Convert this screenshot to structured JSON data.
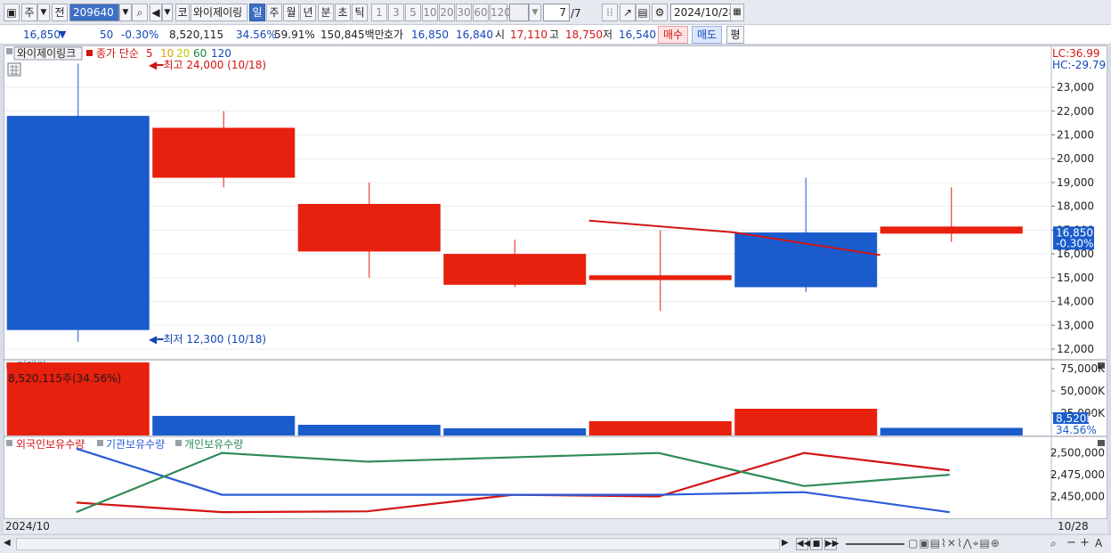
{
  "toolbar": {
    "market_type": "주",
    "prev_label": "전",
    "stock_code": "209640",
    "stock_name_btn": "코",
    "stock_name": "와이제이링",
    "periods": [
      "일",
      "주",
      "월",
      "년",
      "분",
      "초",
      "틱"
    ],
    "active_period": "일",
    "intervals": [
      "1",
      "3",
      "5",
      "10",
      "20",
      "30",
      "60",
      "120"
    ],
    "page_counter": "7",
    "page_total": "/7",
    "date": "2024/10/28"
  },
  "quote": {
    "price": "16,850",
    "direction_icon": "▼",
    "change": "50",
    "change_pct": "-0.30%",
    "volume": "8,520,115",
    "volume_ratio": "34.56%",
    "foreign_ratio": "59.91%",
    "trade_amount": "150,845백만",
    "ask_label": "호가",
    "ask": "16,850",
    "bid": "16,840",
    "open_label": "시",
    "open": "17,110",
    "high_label": "고",
    "high": "18,750",
    "low_label": "저",
    "low": "16,540",
    "buy_label": "매수",
    "sell_label": "매도",
    "eval_label": "평"
  },
  "chart_data": [
    {
      "type": "candlestick",
      "title": "와이제이링크",
      "ma_label": "종가 단순",
      "ma_periods": [
        "5",
        "10",
        "20",
        "60",
        "120"
      ],
      "ma_colors": [
        "#d21414",
        "#e0a000",
        "#c8c800",
        "#1a8a3a",
        "#1446b8"
      ],
      "candles": [
        {
          "open": 21800,
          "high": 24000,
          "low": 12300,
          "close": 12800
        },
        {
          "open": 19200,
          "high": 22000,
          "low": 18800,
          "close": 21300
        },
        {
          "open": 16100,
          "high": 19000,
          "low": 15000,
          "close": 18100
        },
        {
          "open": 14700,
          "high": 16600,
          "low": 14600,
          "close": 16000
        },
        {
          "open": 14900,
          "high": 17000,
          "low": 13600,
          "close": 15100
        },
        {
          "open": 16900,
          "high": 19200,
          "low": 14400,
          "close": 14600
        },
        {
          "open": 16850,
          "high": 18800,
          "low": 16500,
          "close": 17150
        }
      ],
      "ma5": [
        null,
        null,
        null,
        null,
        17400,
        16900,
        15950
      ],
      "ylim": [
        11700,
        24200
      ],
      "yticks": [
        12000,
        13000,
        14000,
        15000,
        16000,
        17000,
        18000,
        19000,
        20000,
        21000,
        22000,
        23000
      ],
      "ytick_labels": [
        "12,000",
        "13,000",
        "14,000",
        "15,000",
        "16,000",
        "17,000",
        "18,000",
        "19,000",
        "20,000",
        "21,000",
        "22,000",
        "23,000"
      ],
      "max_annotation": "최고 24,000 (10/18)",
      "min_annotation": "최저 12,300 (10/18)",
      "lc_label": "LC:36.99",
      "hc_label": "HC:-29.79",
      "last_price_label": "16,850",
      "last_change_label": "-0.30%",
      "up_color": "#e8200e",
      "down_color": "#1a5ccc"
    },
    {
      "type": "bar",
      "title": "거래량",
      "annotation": "8,520,115주(34.56%)",
      "values": [
        95000000,
        22000000,
        12000000,
        8000000,
        16000000,
        30000000,
        8520115
      ],
      "colors": [
        "up",
        "down",
        "down",
        "down",
        "up",
        "up",
        "down"
      ],
      "ylim": [
        0,
        82000000
      ],
      "ytick_labels": [
        "25,000K",
        "50,000K",
        "75,000K"
      ],
      "yticks": [
        25000000,
        50000000,
        75000000
      ],
      "last_label": "8,520K",
      "last_pct": "34.56%"
    },
    {
      "type": "line",
      "series": [
        {
          "name": "외국인보유수량",
          "color": "#d21414",
          "values": [
            2443000,
            2432000,
            2433000,
            2452000,
            2450000,
            2500000,
            2480000
          ]
        },
        {
          "name": "기관보유수량",
          "color": "#2a5bd7",
          "values": [
            2505000,
            2452000,
            2452000,
            2452000,
            2452000,
            2455000,
            2432000
          ]
        },
        {
          "name": "개인보유수량",
          "color": "#2e8b57",
          "values": [
            2432000,
            2500000,
            2490000,
            2495000,
            2500000,
            2462000,
            2475000
          ]
        }
      ],
      "ylim": [
        2425000,
        2515000
      ],
      "yticks": [
        2450000,
        2475000,
        2500000
      ],
      "ytick_labels": [
        "2,450,000",
        "2,475,000",
        "2,500,000"
      ]
    }
  ],
  "footer": {
    "start_date": "2024/10",
    "end_date": "10/28"
  }
}
